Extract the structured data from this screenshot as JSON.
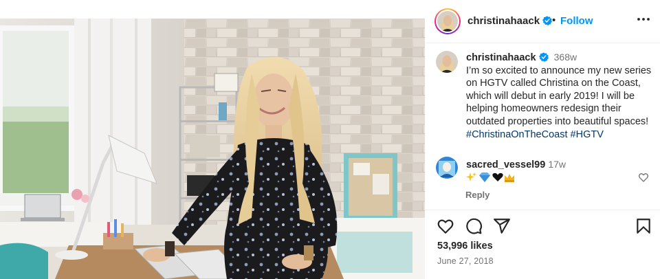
{
  "post": {
    "username": "christinahaack",
    "verified": true,
    "follow_separator": "•",
    "follow_label": "Follow",
    "photo_alt": "Woman in black floral dress standing at a desk in a bright home office"
  },
  "caption": {
    "username": "christinahaack",
    "time": "368w",
    "text": "I’m so excited to announce my new series on HGTV called Christina on the Coast, which will debut in early 2019! I will be helping homeowners redesign their outdated properties into beautiful spaces! ",
    "hashtags": [
      "#ChristinaOnTheCoast",
      "#HGTV"
    ]
  },
  "comments": [
    {
      "username": "sacred_vessel99",
      "time": "17w",
      "emoji": [
        "sparkles",
        "gem",
        "black-heart",
        "crown"
      ],
      "reply_label": "Reply"
    }
  ],
  "footer": {
    "likes": "53,996 likes",
    "date": "June 27, 2018"
  },
  "icons": {
    "more": "more-horizontal-icon",
    "like": "heart-icon",
    "comment": "comment-bubble-icon",
    "share": "paper-plane-icon",
    "save": "bookmark-icon",
    "verified": "verified-badge-icon"
  },
  "colors": {
    "accent": "#0095f6",
    "hashtag": "#00376b",
    "muted": "#737373",
    "text": "#262626"
  }
}
